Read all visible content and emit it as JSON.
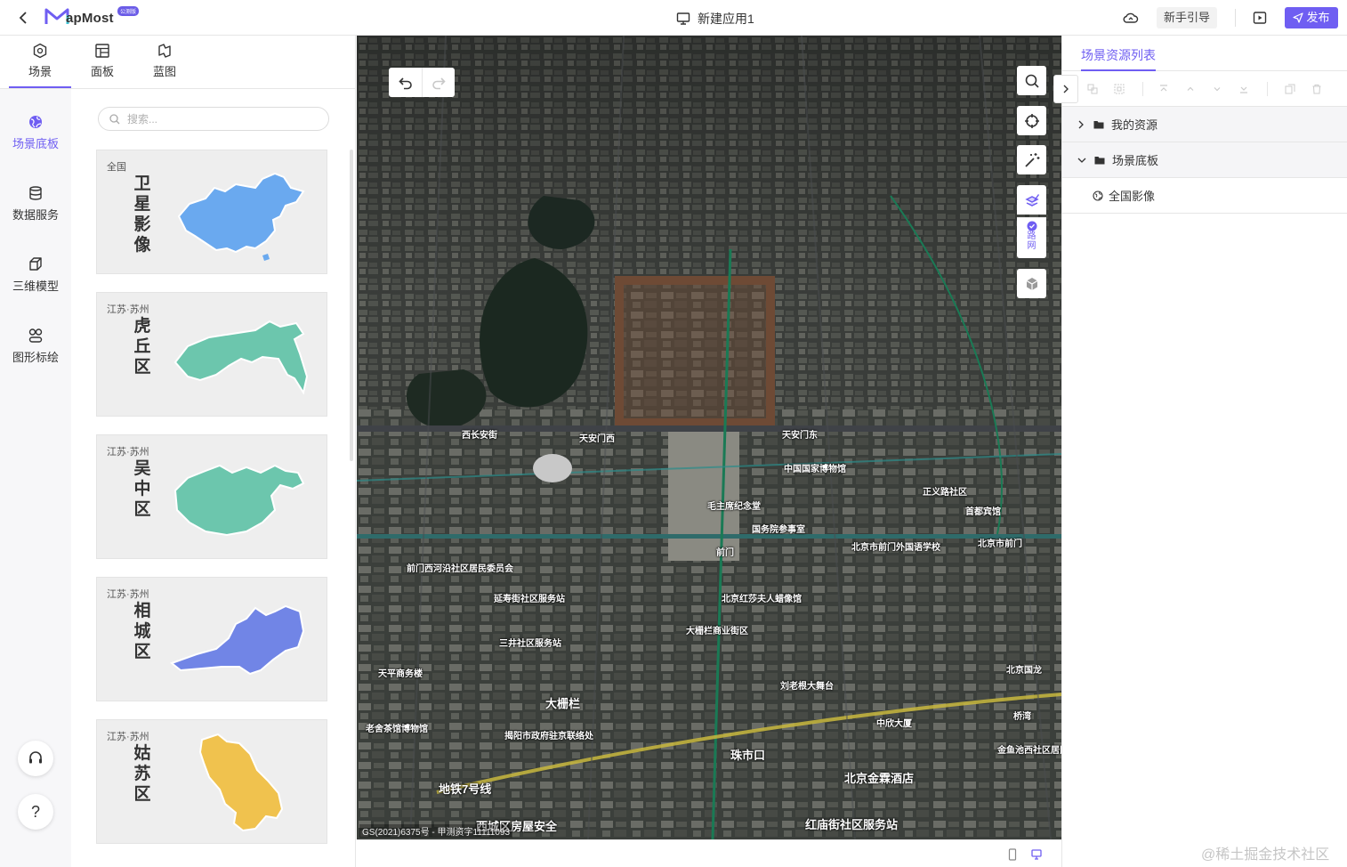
{
  "topbar": {
    "logo_text": "apMost",
    "logo_badge": "公测版",
    "app_title": "新建应用1",
    "guide_label": "新手引导",
    "publish_label": "发布"
  },
  "tabs": [
    {
      "label": "场景"
    },
    {
      "label": "面板"
    },
    {
      "label": "蓝图"
    }
  ],
  "side_nav": [
    {
      "label": "场景底板"
    },
    {
      "label": "数据服务"
    },
    {
      "label": "三维模型"
    },
    {
      "label": "图形标绘"
    }
  ],
  "help_label": "?",
  "search": {
    "placeholder": "搜索..."
  },
  "cards": [
    {
      "region": "全国",
      "name": "卫星影像",
      "color": "#6aa9ef"
    },
    {
      "region": "江苏·苏州",
      "name": "虎丘区",
      "color": "#6cc6ad"
    },
    {
      "region": "江苏·苏州",
      "name": "吴中区",
      "color": "#6cc6ad"
    },
    {
      "region": "江苏·苏州",
      "name": "相城区",
      "color": "#7185e6"
    },
    {
      "region": "江苏·苏州",
      "name": "姑苏区",
      "color": "#f0c24e"
    }
  ],
  "map": {
    "road_label": "路网",
    "credit": "GS(2021)6375号 - 甲测资字11111093",
    "labels": [
      {
        "text": "西长安街",
        "cls": ""
      },
      {
        "text": "天安门西",
        "cls": ""
      },
      {
        "text": "天安门东",
        "cls": ""
      },
      {
        "text": "中国国家博物馆",
        "cls": ""
      },
      {
        "text": "北京市前门外国语学校",
        "cls": ""
      },
      {
        "text": "前门",
        "cls": ""
      },
      {
        "text": "北京红莎夫人蜡像馆",
        "cls": ""
      },
      {
        "text": "大栅栏商业街区",
        "cls": ""
      },
      {
        "text": "三井社区服务站",
        "cls": ""
      },
      {
        "text": "大栅栏",
        "cls": "big"
      },
      {
        "text": "刘老根大舞台",
        "cls": ""
      },
      {
        "text": "北京国龙",
        "cls": ""
      },
      {
        "text": "中欣大厦",
        "cls": ""
      },
      {
        "text": "珠市口",
        "cls": "big"
      },
      {
        "text": "北京金霖酒店",
        "cls": "big"
      },
      {
        "text": "红庙街社区服务站",
        "cls": "big"
      },
      {
        "text": "揭阳市政府驻京联络处",
        "cls": ""
      },
      {
        "text": "老舍茶馆博物馆",
        "cls": ""
      },
      {
        "text": "地铁7号线",
        "cls": "big"
      },
      {
        "text": "西城区房屋安全",
        "cls": "big"
      },
      {
        "text": "天平商务楼",
        "cls": ""
      },
      {
        "text": "延寿街社区服务站",
        "cls": ""
      },
      {
        "text": "前门西河沿社区居民委员会",
        "cls": ""
      },
      {
        "text": "国务院参事室",
        "cls": ""
      },
      {
        "text": "毛主席纪念堂",
        "cls": ""
      },
      {
        "text": "正义路社区",
        "cls": ""
      },
      {
        "text": "首都宾馆",
        "cls": ""
      },
      {
        "text": "北京市前门",
        "cls": ""
      },
      {
        "text": "金鱼池西社区居民",
        "cls": ""
      },
      {
        "text": "桥湾",
        "cls": ""
      }
    ]
  },
  "right_panel": {
    "title": "场景资源列表",
    "tree": [
      {
        "label": "我的资源",
        "type": "group",
        "expanded": false
      },
      {
        "label": "场景底板",
        "type": "group",
        "expanded": true
      },
      {
        "label": "全国影像",
        "type": "leaf"
      }
    ]
  },
  "watermark": "@稀土掘金技术社区"
}
